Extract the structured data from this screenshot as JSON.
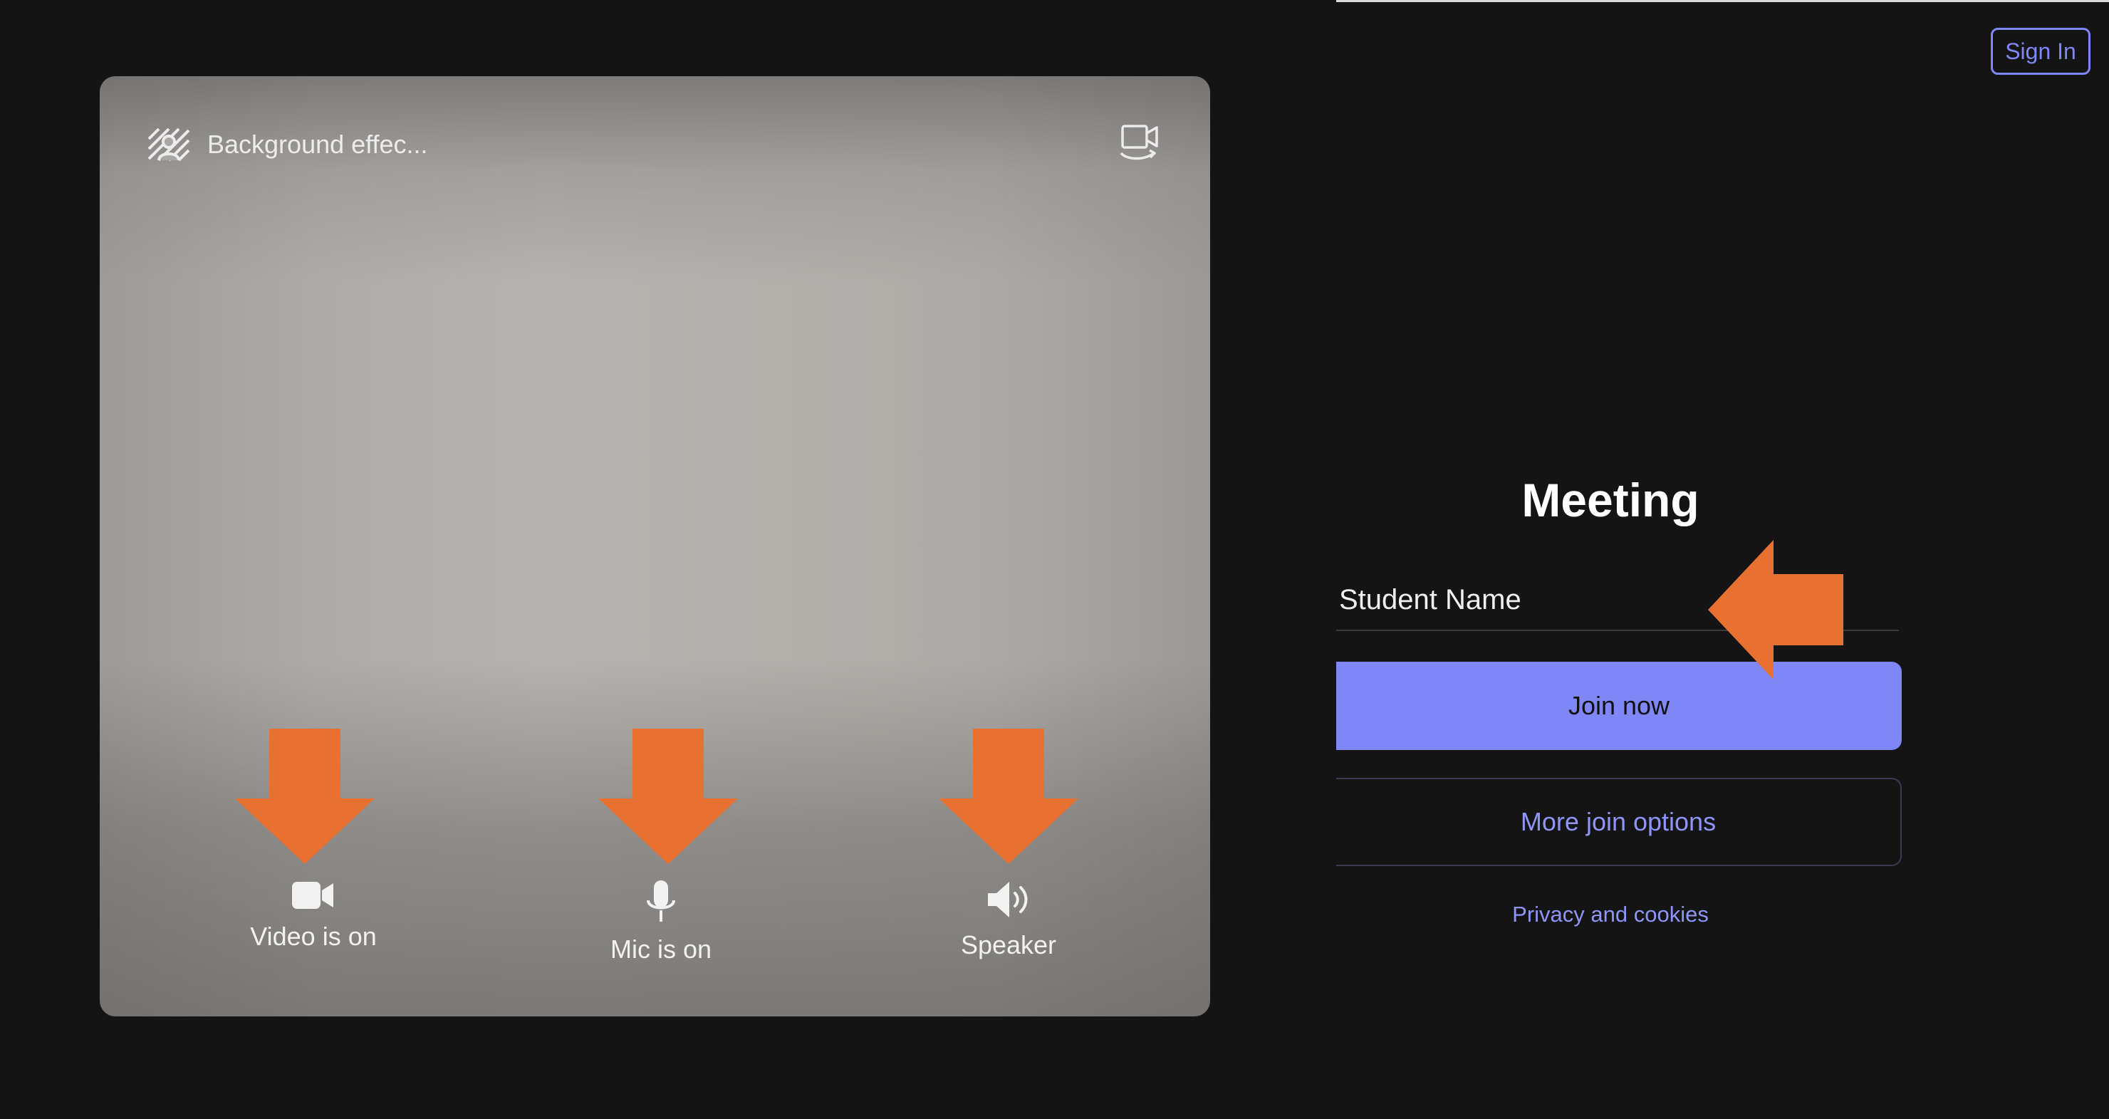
{
  "header": {
    "sign_in_label": "Sign In"
  },
  "preview": {
    "background_effects_label": "Background effec...",
    "controls": {
      "video_label": "Video is on",
      "mic_label": "Mic is on",
      "speaker_label": "Speaker"
    }
  },
  "join_panel": {
    "title": "Meeting",
    "name_value": "Student Name",
    "join_now_label": "Join now",
    "more_options_label": "More join options",
    "privacy_label": "Privacy and cookies"
  },
  "colors": {
    "accent": "#7f86f5",
    "annotation_arrow": "#e87030",
    "background": "#141414"
  },
  "icons": [
    "background-effects-icon",
    "switch-camera-icon",
    "video-camera-icon",
    "microphone-icon",
    "speaker-icon"
  ]
}
